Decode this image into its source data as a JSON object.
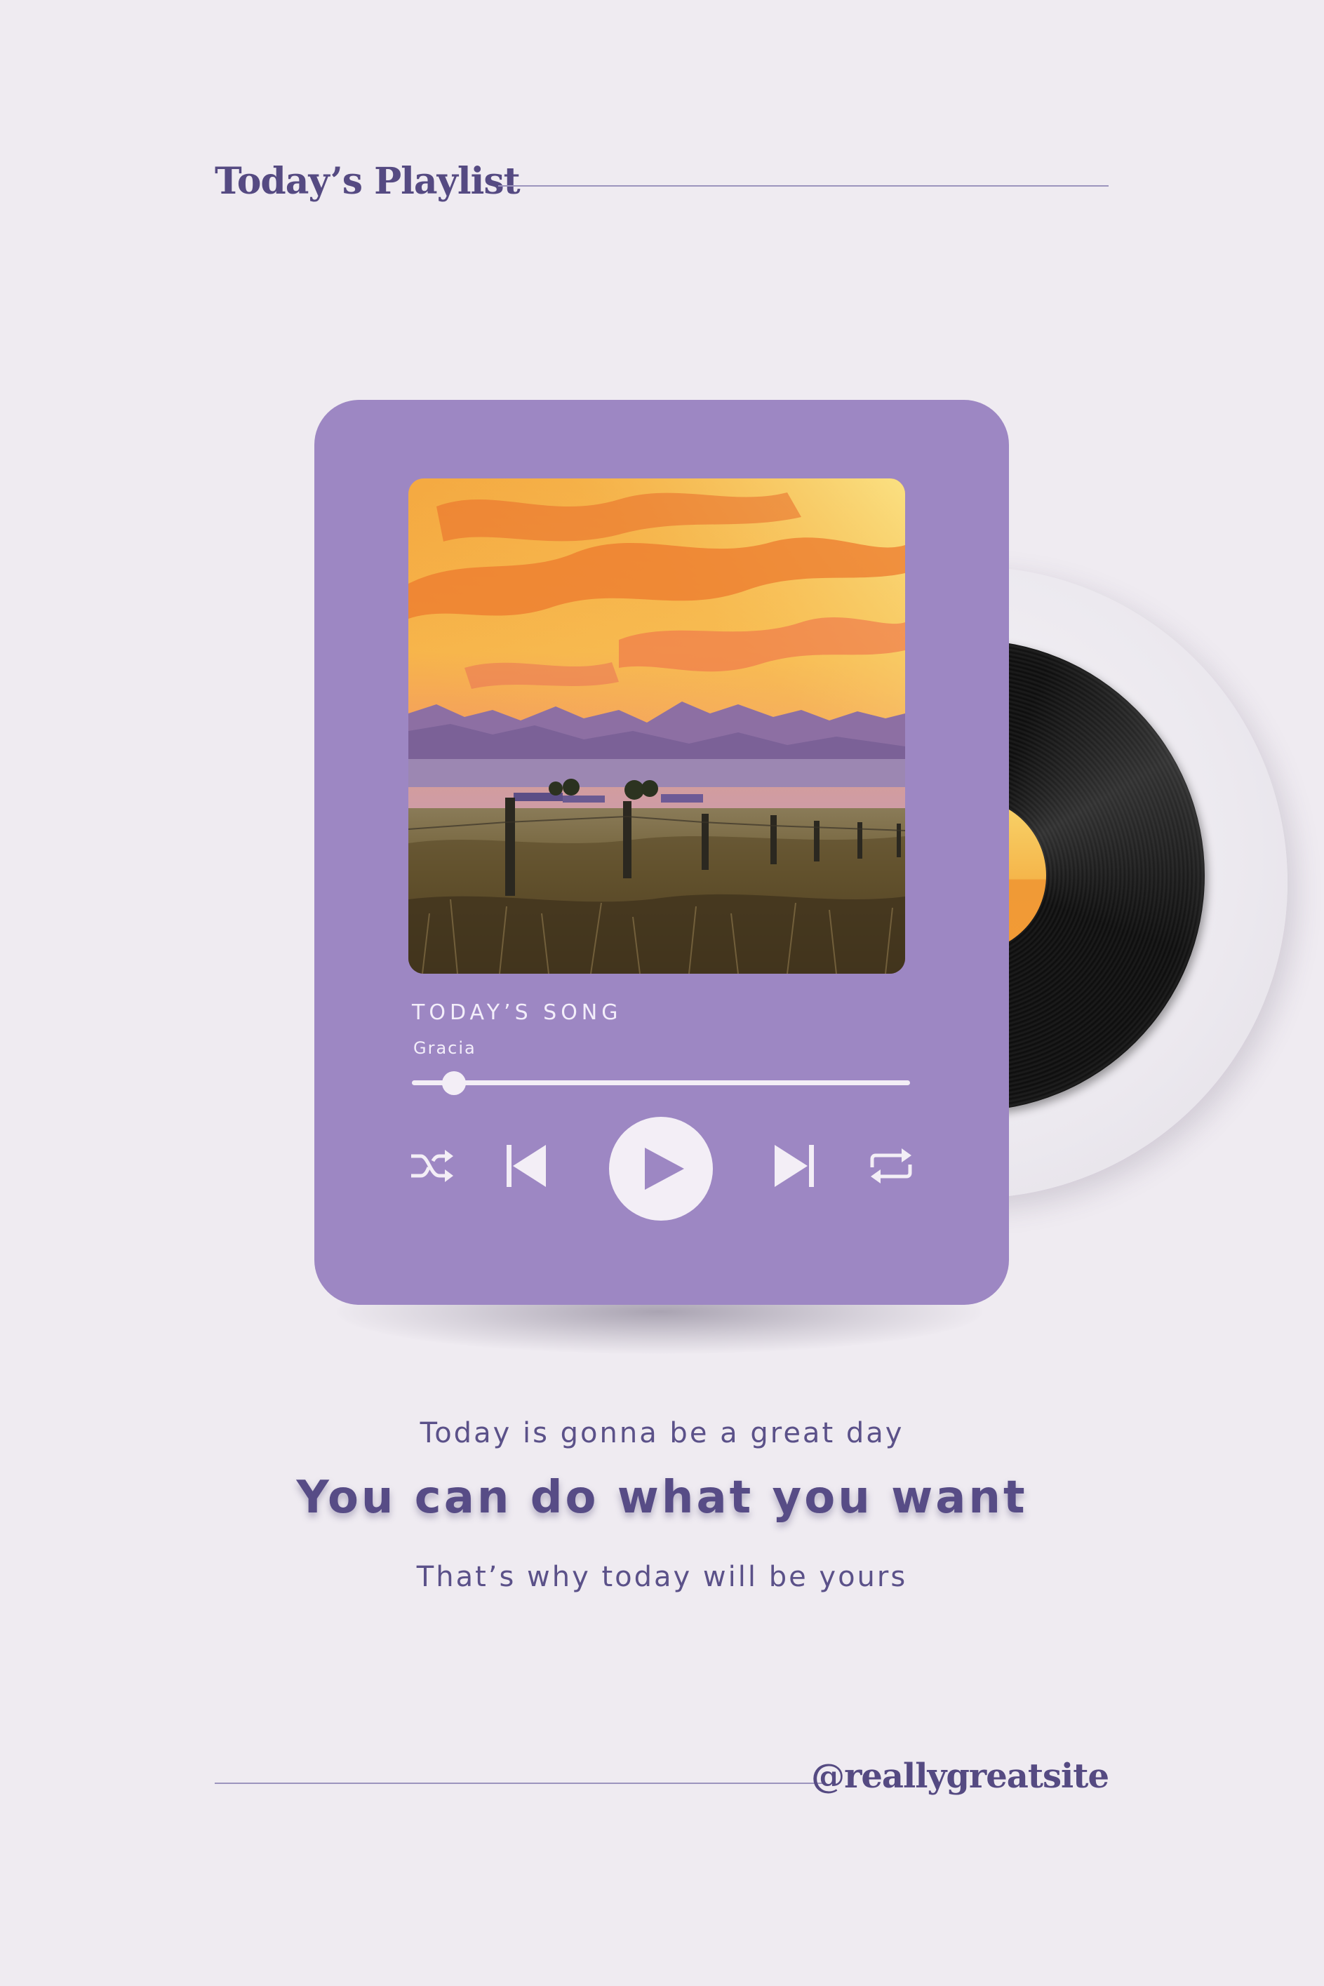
{
  "header": {
    "title": "Today’s Playlist"
  },
  "player": {
    "song_title": "TODAY’S SONG",
    "artist": "Gracia",
    "progress_fraction": 0.085,
    "controls": {
      "shuffle": "shuffle-icon",
      "previous": "skip-previous-icon",
      "play": "play-icon",
      "next": "skip-next-icon",
      "repeat": "repeat-icon"
    }
  },
  "lyrics": {
    "line1": "Today is gonna be a great day",
    "line2": "You can do what you want",
    "line3": "That’s why today will be yours"
  },
  "footer": {
    "handle": "@reallygreatsite"
  },
  "colors": {
    "background": "#efebf1",
    "card": "#9d87c3",
    "accent_text": "#554a82",
    "control_fill": "#f3eef6"
  }
}
